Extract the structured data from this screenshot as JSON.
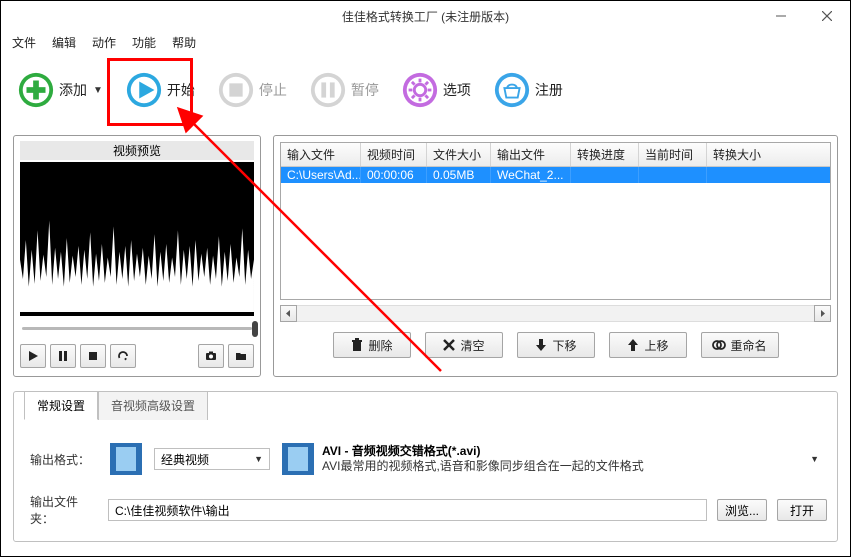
{
  "window": {
    "title": "佳佳格式转换工厂   (未注册版本)"
  },
  "menu": {
    "file": "文件",
    "edit": "编辑",
    "action": "动作",
    "function": "功能",
    "help": "帮助"
  },
  "toolbar": {
    "add": "添加",
    "start": "开始",
    "stop": "停止",
    "pause": "暂停",
    "options": "选项",
    "register": "注册"
  },
  "preview": {
    "title": "视频预览"
  },
  "grid": {
    "headers": {
      "input": "输入文件",
      "duration": "视频时间",
      "size": "文件大小",
      "output": "输出文件",
      "progress": "转换进度",
      "time": "当前时间",
      "outsize": "转换大小"
    },
    "rows": [
      {
        "input": "C:\\Users\\Ad...",
        "duration": "00:00:06",
        "size": "0.05MB",
        "output": "WeChat_2...",
        "progress": "",
        "time": "",
        "outsize": ""
      }
    ]
  },
  "actions": {
    "delete": "删除",
    "clear": "清空",
    "down": "下移",
    "up": "上移",
    "rename": "重命名"
  },
  "tabs": {
    "general": "常规设置",
    "advanced": "音视频高级设置"
  },
  "output": {
    "format_label": "输出格式：",
    "preset": "经典视频",
    "avi_title": "AVI - 音频视频交错格式(*.avi)",
    "avi_desc": "AVI最常用的视频格式,语音和影像同步组合在一起的文件格式",
    "folder_label": "输出文件夹：",
    "folder_path": "C:\\佳佳视频软件\\输出",
    "browse": "浏览...",
    "open": "打开"
  }
}
